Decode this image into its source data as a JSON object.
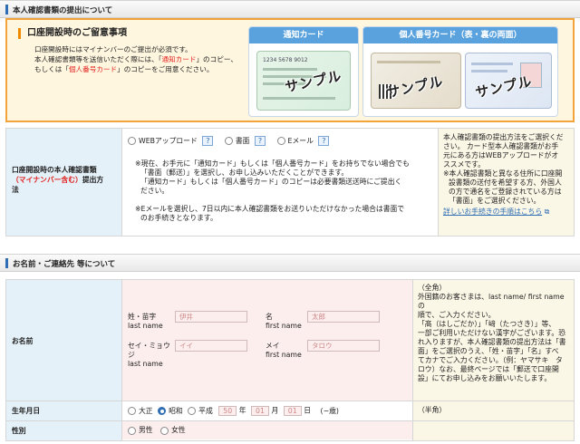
{
  "section1": {
    "title": "本人確認書類の提出について"
  },
  "notice": {
    "title": "口座開設時のご留意事項",
    "line1": "口座開設時にはマイナンバーのご提出が必須です。",
    "line2a": "本人確認書類等を送信いただく際には、「",
    "line2b": "通知カード",
    "line2c": "」のコピー、",
    "line3a": "もしくは「",
    "line3b": "個人番号カード",
    "line3c": "」のコピーをご用意ください。"
  },
  "cards": {
    "tsuchi": {
      "caption": "通知カード",
      "num": "1234 5678 9012",
      "stamp": "サンプル"
    },
    "kojin": {
      "caption": "個人番号カード（表・裏の両面）",
      "stamp": "サンプル"
    }
  },
  "submission": {
    "label1": "口座開設時の本人確認書類",
    "label2": "（マイナンバー含む）",
    "label3": "提出方",
    "label4": "法",
    "options": [
      "WEBアップロード",
      "書面",
      "Eメール"
    ],
    "help": "?",
    "warn1": "※現在、お手元に「通知カード」もしくは「個人番号カード」をお持ちでない場合でも",
    "warn2": "「書面（郵送）」を選択し、お申し込みいただくことができます。",
    "warn3": "「通知カード」もしくは「個人番号カード」のコピーは必要書類送送時にご提出く",
    "warn4": "ださい。",
    "info1": "※Eメールを選択し、7日以内に本人確認書類をお送りいただけなかった場合は書面で",
    "info2": "のお手続きとなります。",
    "side": [
      "本人確認書類の提出方法をご選択くだ",
      "さい。 カード型本人確認書類がお手",
      "元にある方はWEBアップロードがオ",
      "ススメです。",
      "※本人確認書類と異なる住所に口座開",
      "設書類の送付を希望する方、外国人",
      "の方で通名をご登録されている方は",
      "「書面」をご選択ください。"
    ],
    "side_link": "詳しいお手続きの手順はこちら"
  },
  "section2": {
    "title": "お名前・ご連絡先 等について"
  },
  "name_row": {
    "label": "お名前",
    "sei_label1": "姓・苗字",
    "sei_label2": "last name",
    "sei_value": "伊井",
    "mei_label1": "名",
    "mei_label2": "first name",
    "mei_value": "太郎",
    "seikana_label1": "セイ・ミョウ",
    "seikana_label2": "ジ",
    "seikana_label3": "last name",
    "seikana_value": "イイ",
    "meikana_label1": "メイ",
    "meikana_label2": "first name",
    "meikana_value": "タロウ",
    "note": [
      "（全角）",
      "外国籍のお客さまは、last name/ first name の",
      "順で、ご入力ください。",
      "「髙（はしごだか）」「﨑（たつさき）」等、",
      "一部ご利用いただけない漢字がございます。恐",
      "れ入りますが、本人確認書類の提出方法は「書",
      "面」をご選択のうえ、「姓・苗字」「名」すべ",
      "てカナでご入力ください。（例：ヤマサキ　タ",
      "ロウ）なお、最終ページでは「郵送で口座開",
      "設」にてお申し込みをお願いいたします。"
    ]
  },
  "birth_row": {
    "label": "生年月日",
    "eras": [
      "大正",
      "昭和",
      "平成"
    ],
    "year": "50",
    "year_unit": "年",
    "month": "01",
    "month_unit": "月",
    "day": "01",
    "day_unit": "日",
    "age": "(−歳)",
    "note": "（半角）"
  },
  "gender_row": {
    "label": "性別",
    "options": [
      "男性",
      "女性"
    ]
  }
}
